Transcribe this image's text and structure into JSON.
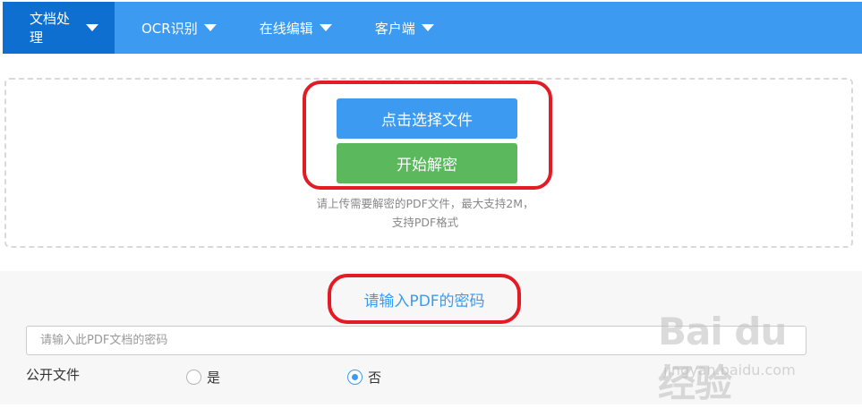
{
  "nav": {
    "items": [
      {
        "label": "文档处理",
        "active": true
      },
      {
        "label": "OCR识别",
        "active": false
      },
      {
        "label": "在线编辑",
        "active": false
      },
      {
        "label": "客户端",
        "active": false
      }
    ]
  },
  "upload": {
    "select_button": "点击选择文件",
    "start_button": "开始解密",
    "hint_line1": "请上传需要解密的PDF文件，最大支持2M，",
    "hint_line2": "支持PDF格式"
  },
  "password": {
    "title": "请输入PDF的密码",
    "input_placeholder": "请输入此PDF文档的密码",
    "public_label": "公开文件",
    "option_yes": "是",
    "option_no": "否",
    "selected": "否"
  },
  "watermark": {
    "logo": "Bai du 经验",
    "url": "jingyan.baidu.com"
  },
  "colors": {
    "nav_bg": "#3c9bf0",
    "nav_active": "#0f6fd1",
    "select_button": "#3c9bf0",
    "start_button": "#5cb85c",
    "highlight_ring": "#e21b24"
  }
}
